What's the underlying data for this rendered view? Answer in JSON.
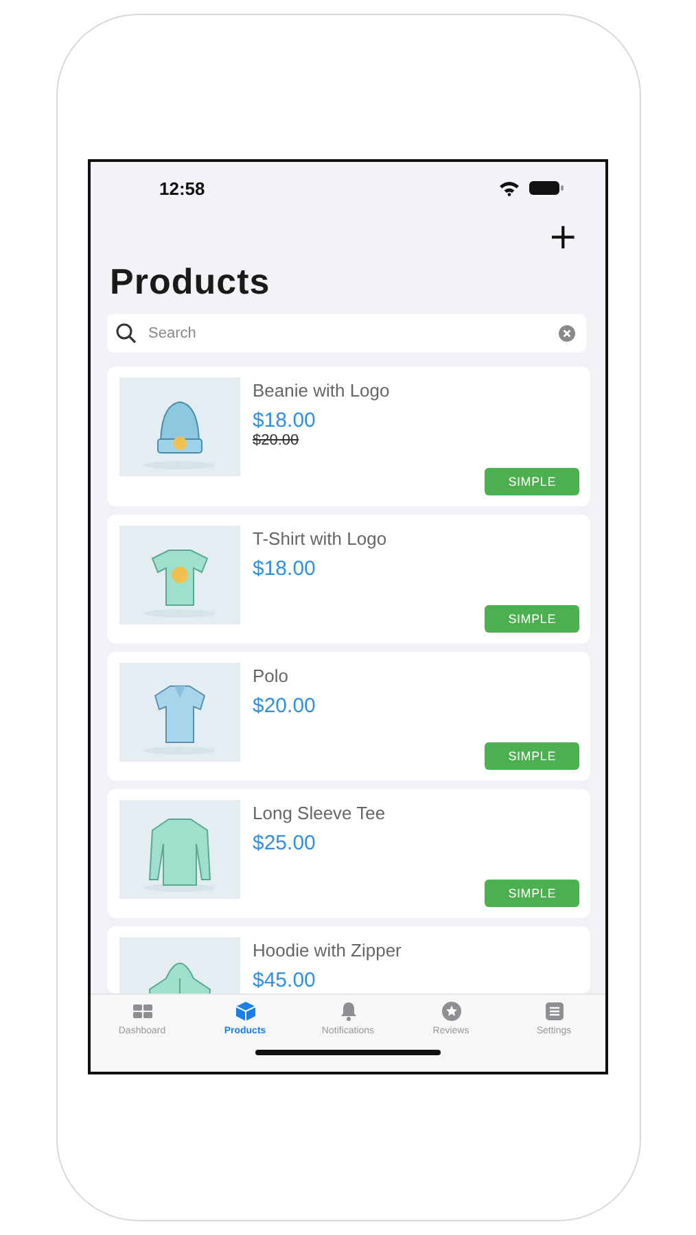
{
  "status_bar": {
    "time": "12:58"
  },
  "header": {
    "add_button": "+",
    "title": "Products"
  },
  "search": {
    "placeholder": "Search"
  },
  "products": [
    {
      "name": "Beanie with Logo",
      "price": "$18.00",
      "old_price": "$20.00",
      "type": "SIMPLE"
    },
    {
      "name": "T-Shirt with Logo",
      "price": "$18.00",
      "type": "SIMPLE"
    },
    {
      "name": "Polo",
      "price": "$20.00",
      "type": "SIMPLE"
    },
    {
      "name": "Long Sleeve Tee",
      "price": "$25.00",
      "type": "SIMPLE"
    },
    {
      "name": "Hoodie with Zipper",
      "price": "$45.00"
    }
  ],
  "tabs": [
    {
      "label": "Dashboard",
      "selected": false
    },
    {
      "label": "Products",
      "selected": true
    },
    {
      "label": "Notifications",
      "selected": false
    },
    {
      "label": "Reviews",
      "selected": false
    },
    {
      "label": "Settings",
      "selected": false
    }
  ]
}
